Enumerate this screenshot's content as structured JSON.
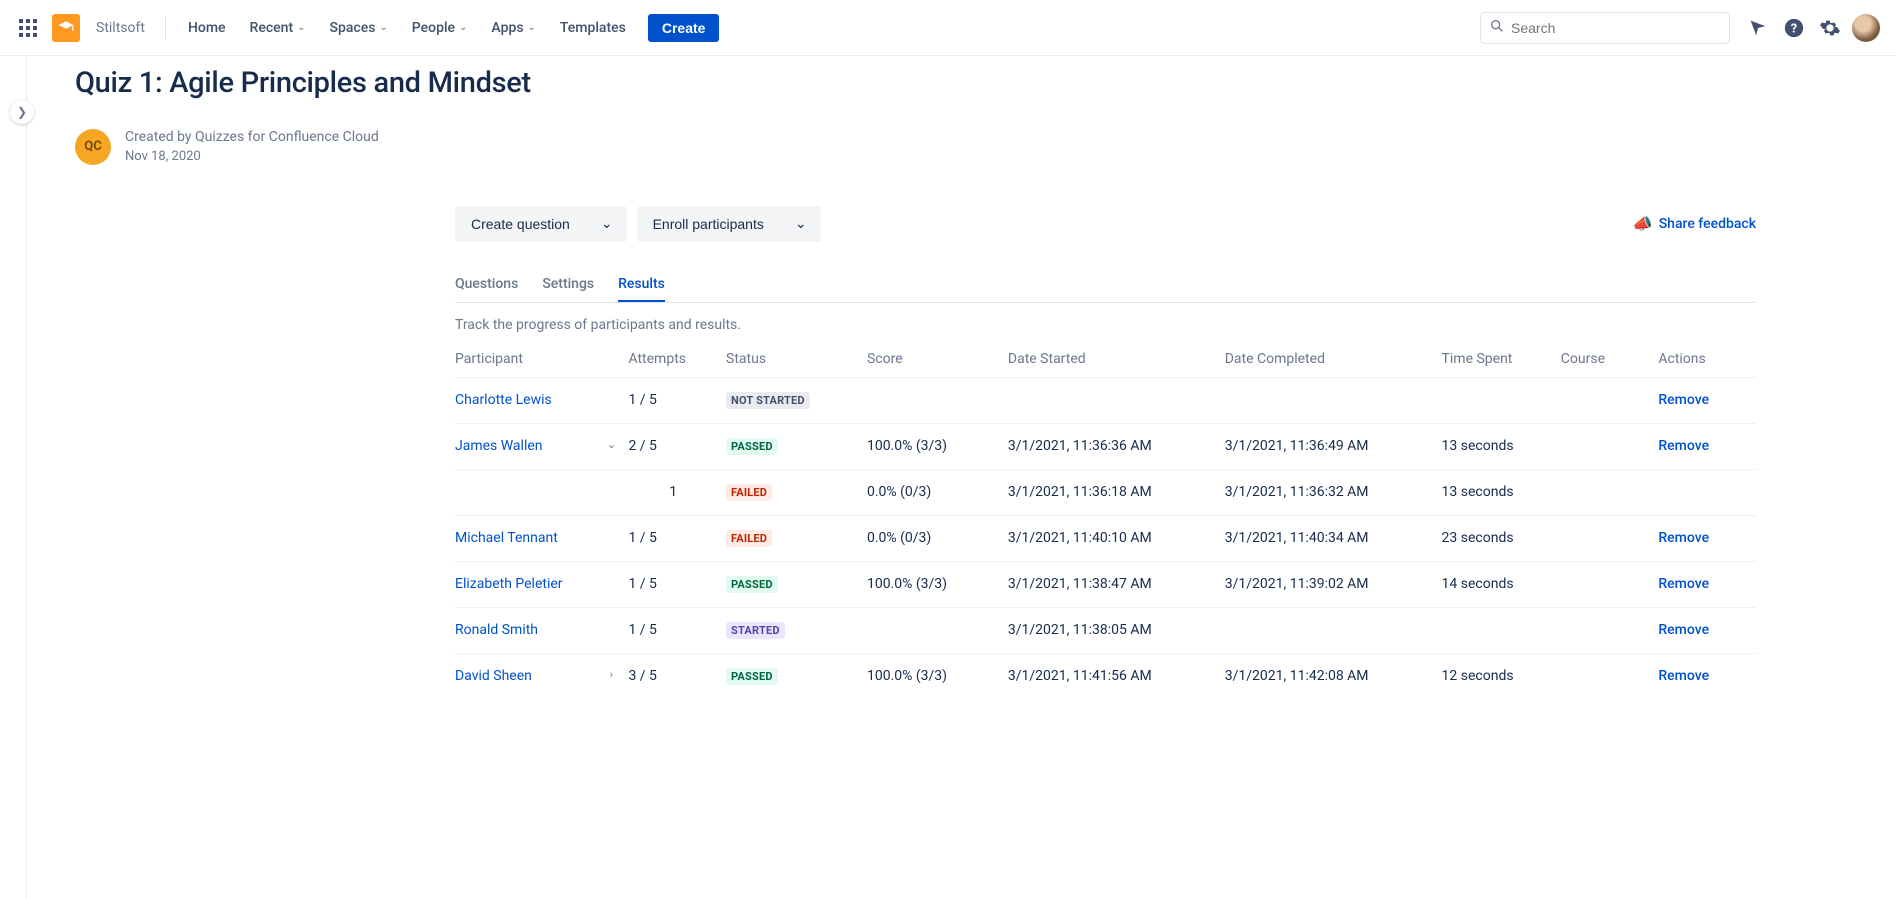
{
  "nav": {
    "space_name": "Stiltsoft",
    "links": [
      "Home",
      "Recent",
      "Spaces",
      "People",
      "Apps",
      "Templates"
    ],
    "links_has_dd": [
      false,
      true,
      true,
      true,
      true,
      false
    ],
    "create": "Create",
    "search_placeholder": "Search"
  },
  "page": {
    "title": "Quiz 1: Agile Principles and Mindset",
    "byline1": "Created by Quizzes for Confluence Cloud",
    "byline2": "Nov 18, 2020",
    "qc_label": "QC"
  },
  "actions": {
    "create_question": "Create question",
    "enroll": "Enroll participants",
    "feedback": "Share feedback"
  },
  "tabs": {
    "q": "Questions",
    "s": "Settings",
    "r": "Results"
  },
  "track": "Track the progress of participants and results.",
  "headers": {
    "participant": "Participant",
    "attempts": "Attempts",
    "status": "Status",
    "score": "Score",
    "ds": "Date Started",
    "dc": "Date Completed",
    "ts": "Time Spent",
    "course": "Course",
    "actions": "Actions"
  },
  "status_labels": {
    "not_started": "NOT STARTED",
    "passed": "PASSED",
    "failed": "FAILED",
    "started": "STARTED"
  },
  "remove_label": "Remove",
  "rows": [
    {
      "name": "Charlotte Lewis",
      "chev": "",
      "att": "1 / 5",
      "status": "not_started",
      "score": "",
      "ds": "",
      "dc": "",
      "ts": "",
      "course": "",
      "remove": true
    },
    {
      "name": "James Wallen",
      "chev": "down",
      "att": "2 / 5",
      "status": "passed",
      "score": "100.0% (3/3)",
      "ds": "3/1/2021, 11:36:36 AM",
      "dc": "3/1/2021, 11:36:49 AM",
      "ts": "13 seconds",
      "course": "",
      "remove": true
    },
    {
      "sub": true,
      "name": "",
      "chev": "",
      "att": "1",
      "status": "failed",
      "score": "0.0% (0/3)",
      "ds": "3/1/2021, 11:36:18 AM",
      "dc": "3/1/2021, 11:36:32 AM",
      "ts": "13 seconds",
      "course": "",
      "remove": false
    },
    {
      "name": "Michael Tennant",
      "chev": "",
      "att": "1 / 5",
      "status": "failed",
      "score": "0.0% (0/3)",
      "ds": "3/1/2021, 11:40:10 AM",
      "dc": "3/1/2021, 11:40:34 AM",
      "ts": "23 seconds",
      "course": "",
      "remove": true
    },
    {
      "name": "Elizabeth Peletier",
      "chev": "",
      "att": "1 / 5",
      "status": "passed",
      "score": "100.0% (3/3)",
      "ds": "3/1/2021, 11:38:47 AM",
      "dc": "3/1/2021, 11:39:02 AM",
      "ts": "14 seconds",
      "course": "",
      "remove": true
    },
    {
      "name": "Ronald Smith",
      "chev": "",
      "att": "1 / 5",
      "status": "started",
      "score": "",
      "ds": "3/1/2021, 11:38:05 AM",
      "dc": "",
      "ts": "",
      "course": "",
      "remove": true
    },
    {
      "name": "David Sheen",
      "chev": "right",
      "att": "3 / 5",
      "status": "passed",
      "score": "100.0% (3/3)",
      "ds": "3/1/2021, 11:41:56 AM",
      "dc": "3/1/2021, 11:42:08 AM",
      "ts": "12 seconds",
      "course": "",
      "remove": true
    }
  ]
}
